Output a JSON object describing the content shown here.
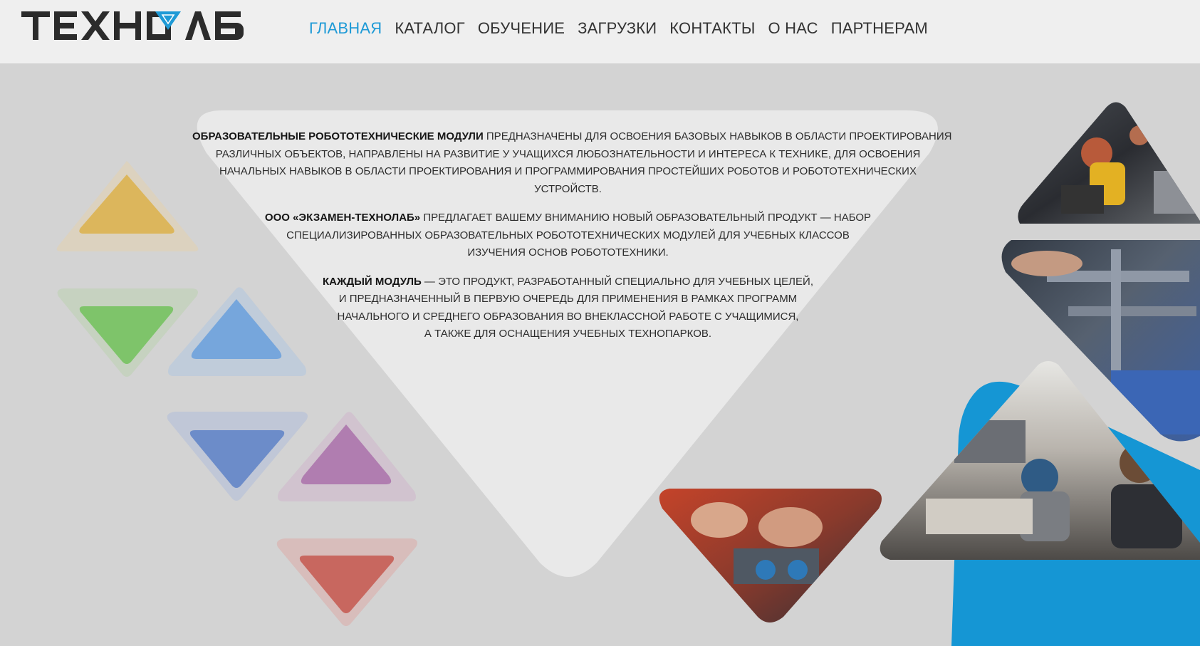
{
  "brand": {
    "logo_text": "ТЕХНОЛАБ"
  },
  "nav": {
    "items": [
      {
        "label": "ГЛАВНАЯ",
        "active": true
      },
      {
        "label": "КАТАЛОГ",
        "active": false
      },
      {
        "label": "ОБУЧЕНИЕ",
        "active": false
      },
      {
        "label": "ЗАГРУЗКИ",
        "active": false
      },
      {
        "label": "КОНТАКТЫ",
        "active": false
      },
      {
        "label": "О НАС",
        "active": false
      },
      {
        "label": "ПАРТНЕРАМ",
        "active": false
      }
    ]
  },
  "intro": {
    "p1": {
      "bold": "ОБРАЗОВАТЕЛЬНЫЕ РОБОТОТЕХНИЧЕСКИЕ МОДУЛИ",
      "line1_rest": " ПРЕДНАЗНАЧЕНЫ ДЛЯ ОСВОЕНИЯ БАЗОВЫХ НАВЫКОВ В ОБЛАСТИ ПРОЕКТИРОВАНИЯ",
      "line2": "РАЗЛИЧНЫХ ОБЪЕКТОВ, НАПРАВЛЕНЫ НА РАЗВИТИЕ У УЧАЩИХСЯ ЛЮБОЗНАТЕЛЬНОСТИ И ИНТЕРЕСА К ТЕХНИКЕ, ДЛЯ ОСВОЕНИЯ",
      "line3": "НАЧАЛЬНЫХ НАВЫКОВ В ОБЛАСТИ ПРОЕКТИРОВАНИЯ И ПРОГРАММИРОВАНИЯ ПРОСТЕЙШИХ РОБОТОВ И РОБОТОТЕХНИЧЕСКИХ",
      "line4": "УСТРОЙСТВ."
    },
    "p2": {
      "bold": "ООО «ЭКЗАМЕН-ТЕХНОЛАБ»",
      "line1_rest": " ПРЕДЛАГАЕТ ВАШЕМУ ВНИМАНИЮ НОВЫЙ ОБРАЗОВАТЕЛЬНЫЙ ПРОДУКТ — НАБОР",
      "line2": "СПЕЦИАЛИЗИРОВАННЫХ ОБРАЗОВАТЕЛЬНЫХ РОБОТОТЕХНИЧЕСКИХ МОДУЛЕЙ ДЛЯ УЧЕБНЫХ КЛАССОВ",
      "line3": "ИЗУЧЕНИЯ ОСНОВ РОБОТОТЕХНИКИ."
    },
    "p3": {
      "bold": "КАЖДЫЙ МОДУЛЬ",
      "line1_rest": " — ЭТО ПРОДУКТ, РАЗРАБОТАННЫЙ СПЕЦИАЛЬНО ДЛЯ УЧЕБНЫХ ЦЕЛЕЙ,",
      "line2": "И ПРЕДНАЗНАЧЕННЫЙ В ПЕРВУЮ ОЧЕРЕДЬ ДЛЯ ПРИМЕНЕНИЯ В РАМКАХ ПРОГРАММ",
      "line3": "НАЧАЛЬНОГО И СРЕДНЕГО ОБРАЗОВАНИЯ ВО ВНЕКЛАССНОЙ РАБОТЕ С УЧАЩИМИСЯ,",
      "line4": "А ТАКЖЕ ДЛЯ ОСНАЩЕНИЯ УЧЕБНЫХ ТЕХНОПАРКОВ."
    }
  },
  "colors": {
    "accent": "#1e9ad6",
    "triangle_yellow": "#dcb65c",
    "triangle_green": "#7ec46a",
    "triangle_lightblue": "#76a6dc",
    "triangle_blue": "#6c8cc9",
    "triangle_purple": "#b07db0",
    "triangle_red": "#c8675f"
  },
  "photos": [
    {
      "name": "photo-robot-workshop",
      "subject": "students assembling a robot"
    },
    {
      "name": "photo-robot-closeup",
      "subject": "hands working on a metal robot frame"
    },
    {
      "name": "photo-classroom",
      "subject": "teenagers building a robot at a desk"
    },
    {
      "name": "photo-hands-parts",
      "subject": "hands holding robot components"
    }
  ]
}
